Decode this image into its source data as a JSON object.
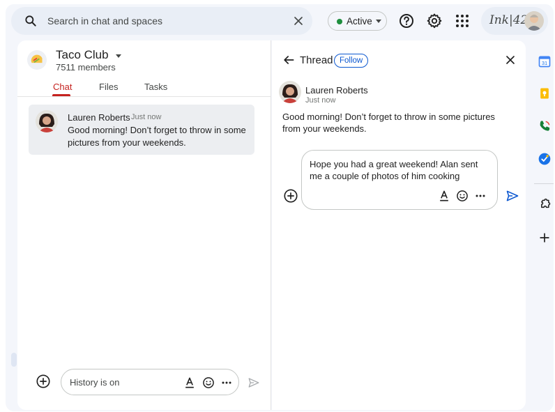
{
  "search": {
    "placeholder": "Search in chat and spaces"
  },
  "status": {
    "label": "Active"
  },
  "brand": {
    "text": "Ink|42"
  },
  "space": {
    "name": "Taco Club",
    "members": "7511 members",
    "tabs": [
      {
        "label": "Chat",
        "active": true
      },
      {
        "label": "Files",
        "active": false
      },
      {
        "label": "Tasks",
        "active": false
      }
    ]
  },
  "messages": [
    {
      "author": "Lauren Roberts",
      "time": "Just now",
      "text": "Good morning! Don’t forget to throw in some pictures from your weekends."
    }
  ],
  "compose": {
    "placeholder": "History is on"
  },
  "thread": {
    "title": "Thread",
    "follow_label": "Follow",
    "author": "Lauren Roberts",
    "time": "Just now",
    "text": "Good morning! Don’t forget to throw in some pictures from your weekends.",
    "reply_text": "Hope you had a great weekend! Alan sent me a couple of photos of him cooking"
  },
  "rail": {
    "items": [
      {
        "icon": "calendar-icon"
      },
      {
        "icon": "keep-icon"
      },
      {
        "icon": "phone-icon"
      },
      {
        "icon": "tasks-icon"
      },
      {
        "icon": "addon-icon"
      },
      {
        "icon": "add-icon"
      }
    ]
  },
  "colors": {
    "accent": "#0b57d0",
    "active_tab": "#c5221f",
    "status_green": "#1e8e3e"
  }
}
